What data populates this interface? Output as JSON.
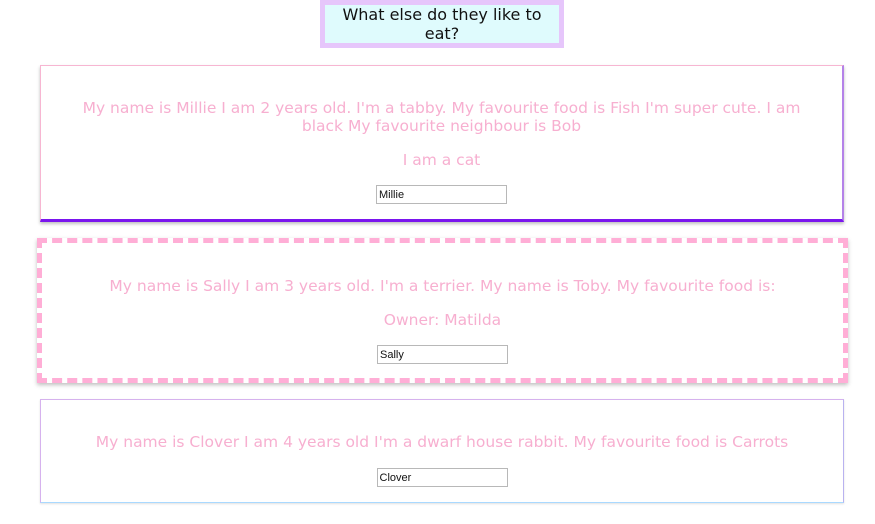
{
  "header": {
    "button_label": "What else do they like to eat?"
  },
  "cards": [
    {
      "intro": "My name is Millie I am 2 years old. I'm a tabby. My favourite food is Fish I'm super cute. I am black My favourite neighbour is Bob",
      "role": "I am a cat",
      "name_value": "Millie"
    },
    {
      "intro": "My name is Sally I am 3 years old. I'm a terrier. My name is Toby. My favourite food is:",
      "owner": "Owner: Matilda",
      "name_value": "Sally"
    },
    {
      "intro": "My name is Clover I am 4 years old I'm a dwarf house rabbit. My favourite food is Carrots",
      "name_value": "Clover"
    }
  ],
  "colors": {
    "text_pink": "#f7afd0",
    "button_bg": "#dffbfd",
    "button_border": "#e6c6fb",
    "card1_accent": "#7a15ee",
    "card2_dash": "#ffaed6"
  }
}
